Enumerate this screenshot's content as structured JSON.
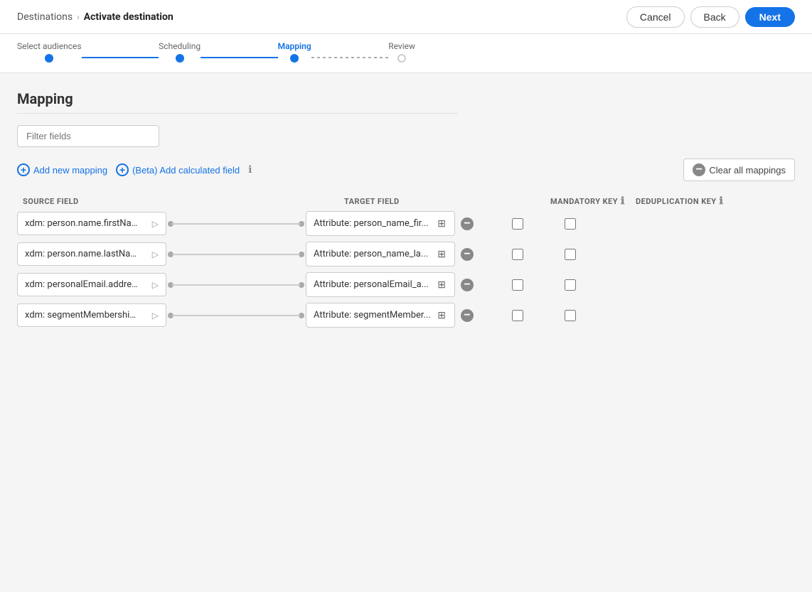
{
  "header": {
    "breadcrumb_parent": "Destinations",
    "breadcrumb_separator": "›",
    "breadcrumb_current": "Activate destination",
    "cancel_label": "Cancel",
    "back_label": "Back",
    "next_label": "Next"
  },
  "stepper": {
    "steps": [
      {
        "label": "Select audiences",
        "state": "completed"
      },
      {
        "label": "Scheduling",
        "state": "completed"
      },
      {
        "label": "Mapping",
        "state": "active"
      },
      {
        "label": "Review",
        "state": "inactive"
      }
    ]
  },
  "mapping": {
    "section_title": "Mapping",
    "filter_placeholder": "Filter fields",
    "add_mapping_label": "Add new mapping",
    "add_calc_label": "(Beta) Add calculated field",
    "clear_all_label": "Clear all mappings",
    "columns": {
      "source": "SOURCE FIELD",
      "target": "TARGET FIELD",
      "mandatory": "MANDATORY KEY",
      "dedup": "DEDUPLICATION KEY"
    },
    "rows": [
      {
        "source": "xdm: person.name.firstName",
        "target": "Attribute: person_name_fir..."
      },
      {
        "source": "xdm: person.name.lastName",
        "target": "Attribute: person_name_la..."
      },
      {
        "source": "xdm: personalEmail.address",
        "target": "Attribute: personalEmail_a..."
      },
      {
        "source": "xdm: segmentMembership....",
        "target": "Attribute: segmentMember..."
      }
    ]
  }
}
